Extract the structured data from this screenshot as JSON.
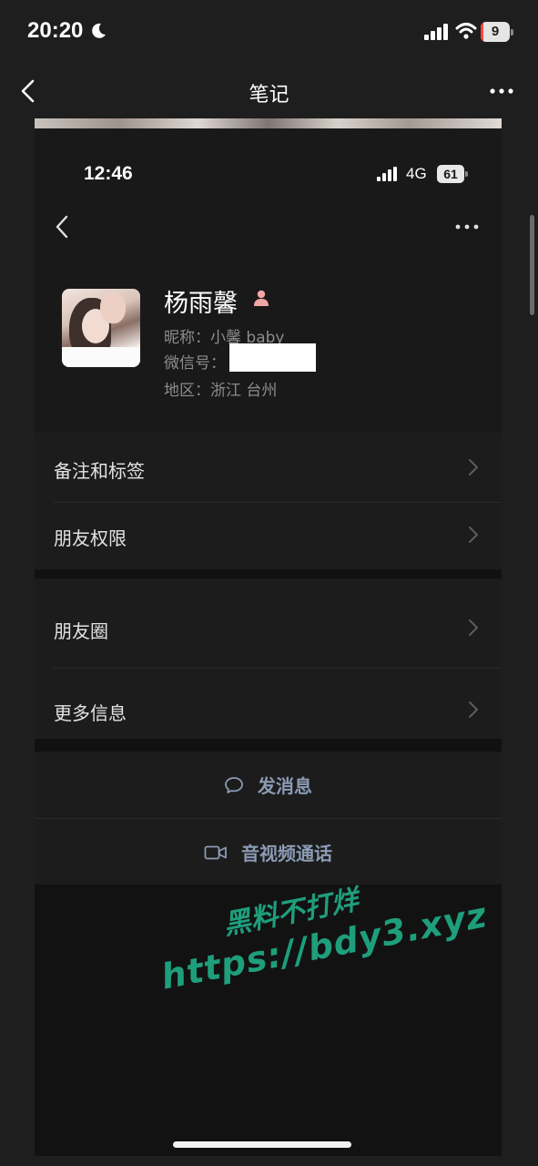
{
  "outer_status": {
    "time": "20:20",
    "battery": "9",
    "battery_fraction": 0.09
  },
  "outer_nav": {
    "title": "笔记"
  },
  "screenshot": {
    "status": {
      "time": "12:46",
      "network": "4G",
      "battery": "61"
    },
    "profile": {
      "name": "杨雨馨",
      "nickname": "昵称：小馨 baby",
      "wechat_id_label": "微信号：",
      "region": "地区：浙江 台州"
    },
    "menu": {
      "remark_tags": "备注和标签",
      "friend_permissions": "朋友权限",
      "moments": "朋友圈",
      "more_info": "更多信息"
    },
    "actions": {
      "send_message": "发消息",
      "av_call": "音视频通话"
    }
  },
  "watermark": {
    "line1": "黑料不打烊",
    "line2": "https://bdy3.xyz"
  },
  "colors": {
    "background": "#1e1e1e",
    "action_text": "#8b9bb4",
    "watermark": "#1f9e7c",
    "gender_icon": "#f2a6a6",
    "battery_low": "#ff453a"
  }
}
